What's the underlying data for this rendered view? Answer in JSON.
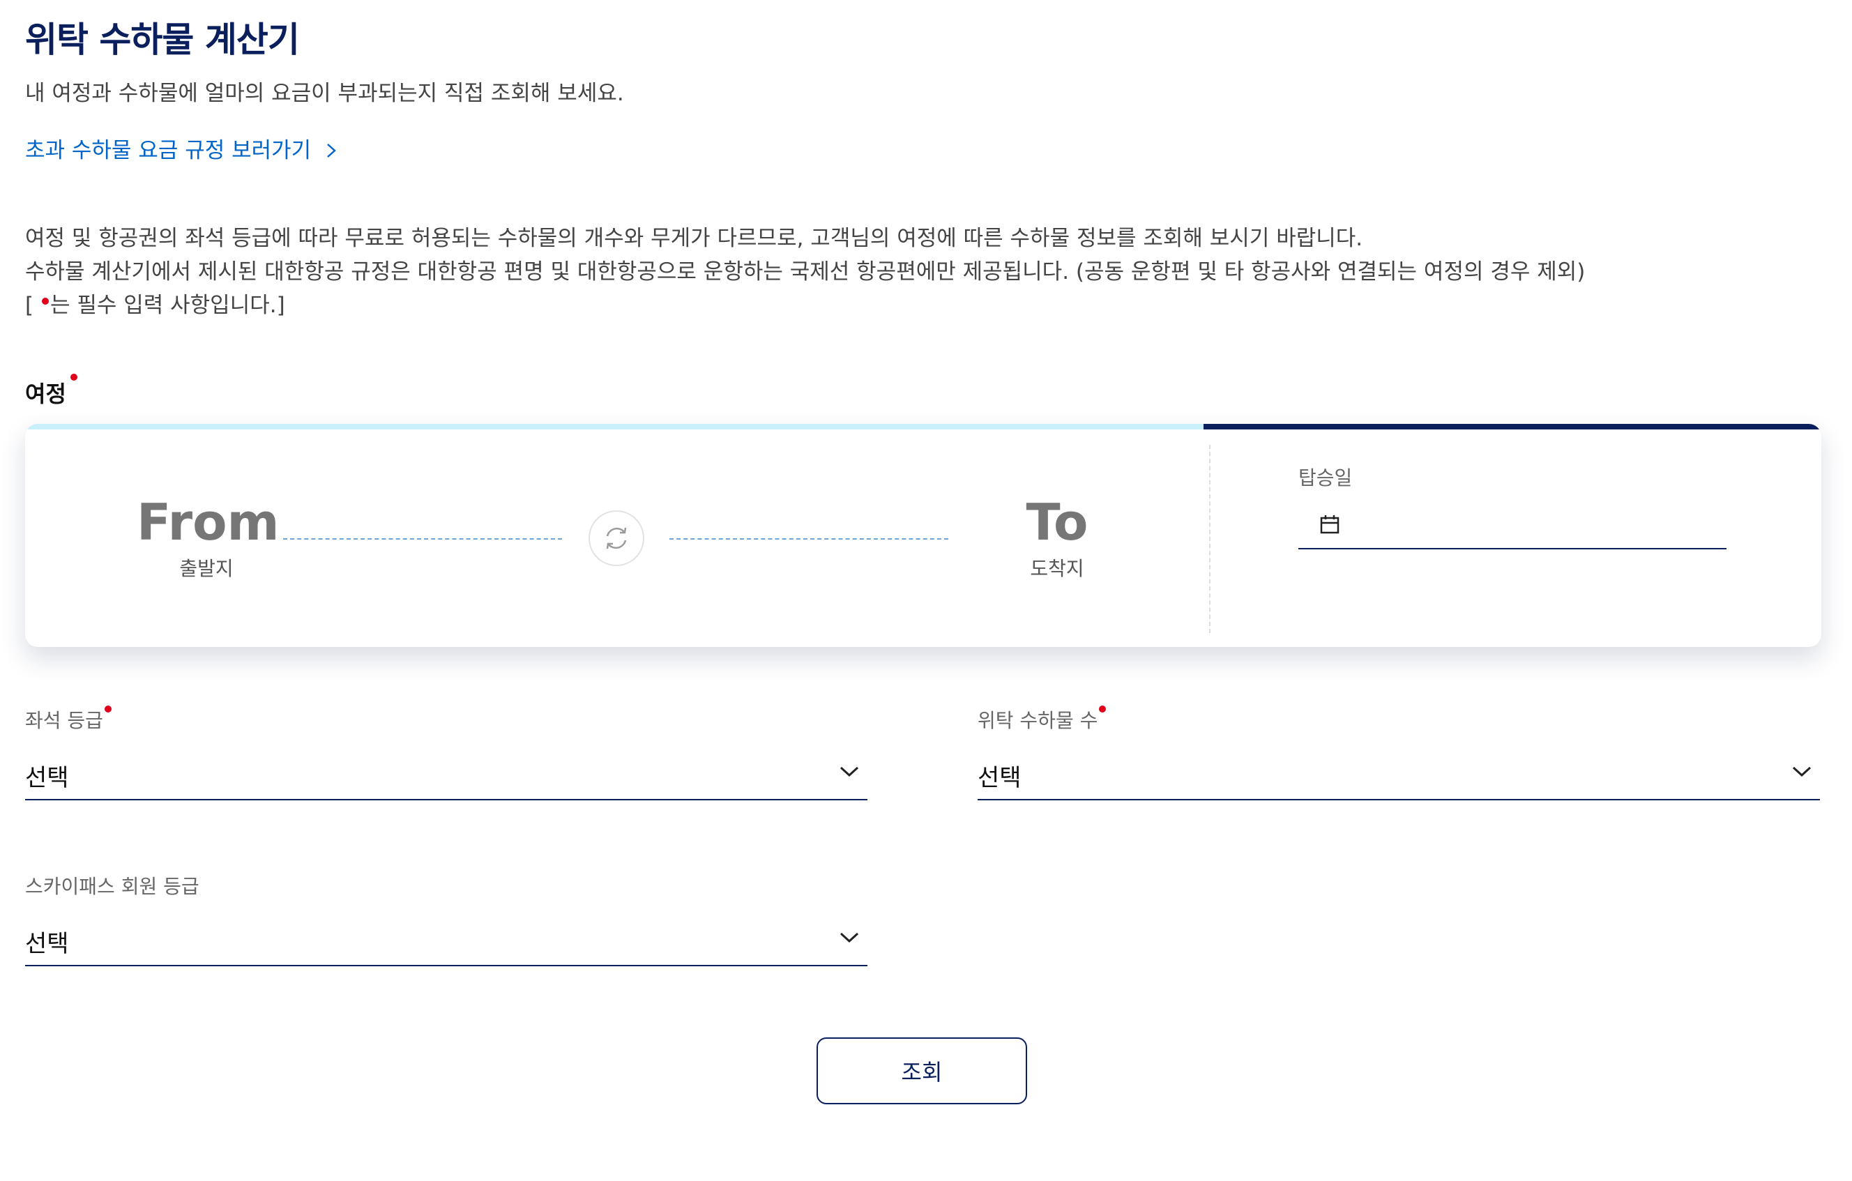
{
  "header": {
    "title": "위탁 수하물 계산기",
    "subtitle": "내 여정과 수하물에 얼마의 요금이 부과되는지 직접 조회해 보세요.",
    "rules_link": "초과 수하물 요금 규정 보러가기"
  },
  "notice": {
    "line1": "여정 및 항공권의 좌석 등급에 따라 무료로 허용되는 수하물의 개수와 무게가 다르므로, 고객님의 여정에 따른 수하물 정보를 조회해 보시기 바랍니다.",
    "line2": "수하물 계산기에서 제시된 대한항공 규정은 대한항공 편명 및 대한항공으로 운항하는 국제선 항공편에만 제공됩니다. (공동 운항편 및 타 항공사와 연결되는 여정의 경우 제외)",
    "line3_open": "[",
    "line3_text": "는 필수 입력 사항입니다.]"
  },
  "journey": {
    "label": "여정",
    "from_code": "From",
    "from_name": "출발지",
    "to_code": "To",
    "to_name": "도착지",
    "date_label": "탑승일",
    "date_value": ""
  },
  "seat_class": {
    "label": "좌석 등급",
    "value": "선택"
  },
  "bag_count": {
    "label": "위탁 수하물 수",
    "value": "선택"
  },
  "skypass": {
    "label": "스카이패스 회원 등급",
    "value": "선택"
  },
  "search_button": "조회",
  "colors": {
    "brand_navy": "#0a1f5c",
    "link_blue": "#0064c8",
    "required_red": "#e0001a",
    "accent_cyan": "#c9f0fb"
  },
  "icons": [
    "chevron-right-icon",
    "swap-icon",
    "calendar-icon",
    "chevron-down-icon"
  ]
}
